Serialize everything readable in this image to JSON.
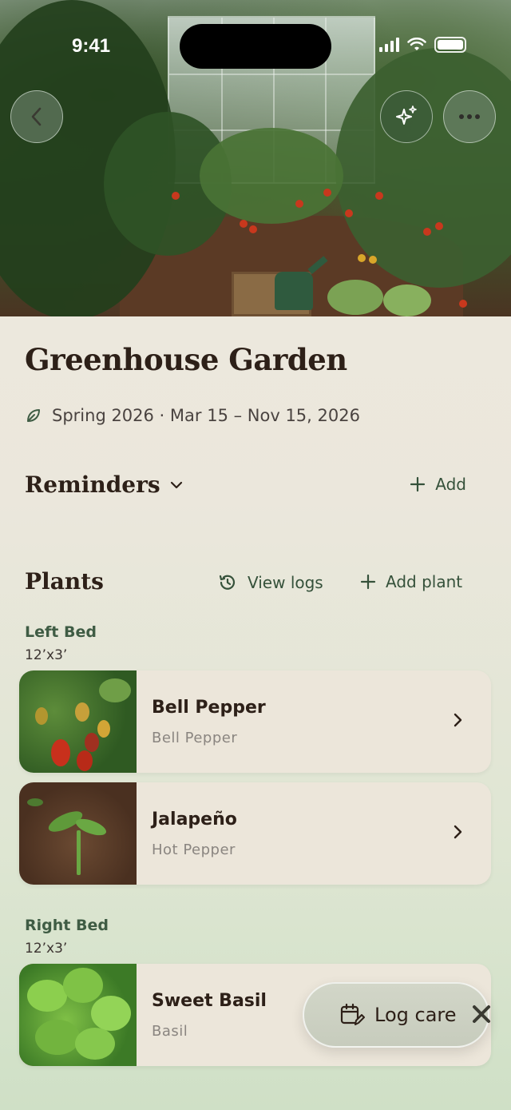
{
  "status_bar": {
    "time": "9:41"
  },
  "header": {
    "back_icon": "chevron-left-icon",
    "ai_icon": "sparkles-icon",
    "more_icon": "more-horizontal-icon"
  },
  "garden": {
    "title": "Greenhouse Garden",
    "season_icon": "leaf-icon",
    "season": "Spring 2026 · Mar 15 – Nov 15, 2026"
  },
  "reminders": {
    "title": "Reminders",
    "add_label": "Add"
  },
  "plants": {
    "title": "Plants",
    "view_logs_label": "View logs",
    "add_plant_label": "Add plant",
    "beds": [
      {
        "name": "Left Bed",
        "size": "12’x3’",
        "items": [
          {
            "name": "Bell Pepper",
            "type": "Bell Pepper"
          },
          {
            "name": "Jalapeño",
            "type": "Hot Pepper"
          }
        ]
      },
      {
        "name": "Right Bed",
        "size": "12’x3’",
        "items": [
          {
            "name": "Sweet Basil",
            "type": "Basil"
          }
        ]
      }
    ]
  },
  "fab": {
    "label": "Log care",
    "icon": "calendar-edit-icon"
  },
  "colors": {
    "accent": "#35513a",
    "title": "#2d2018",
    "card": "#ece6da"
  }
}
